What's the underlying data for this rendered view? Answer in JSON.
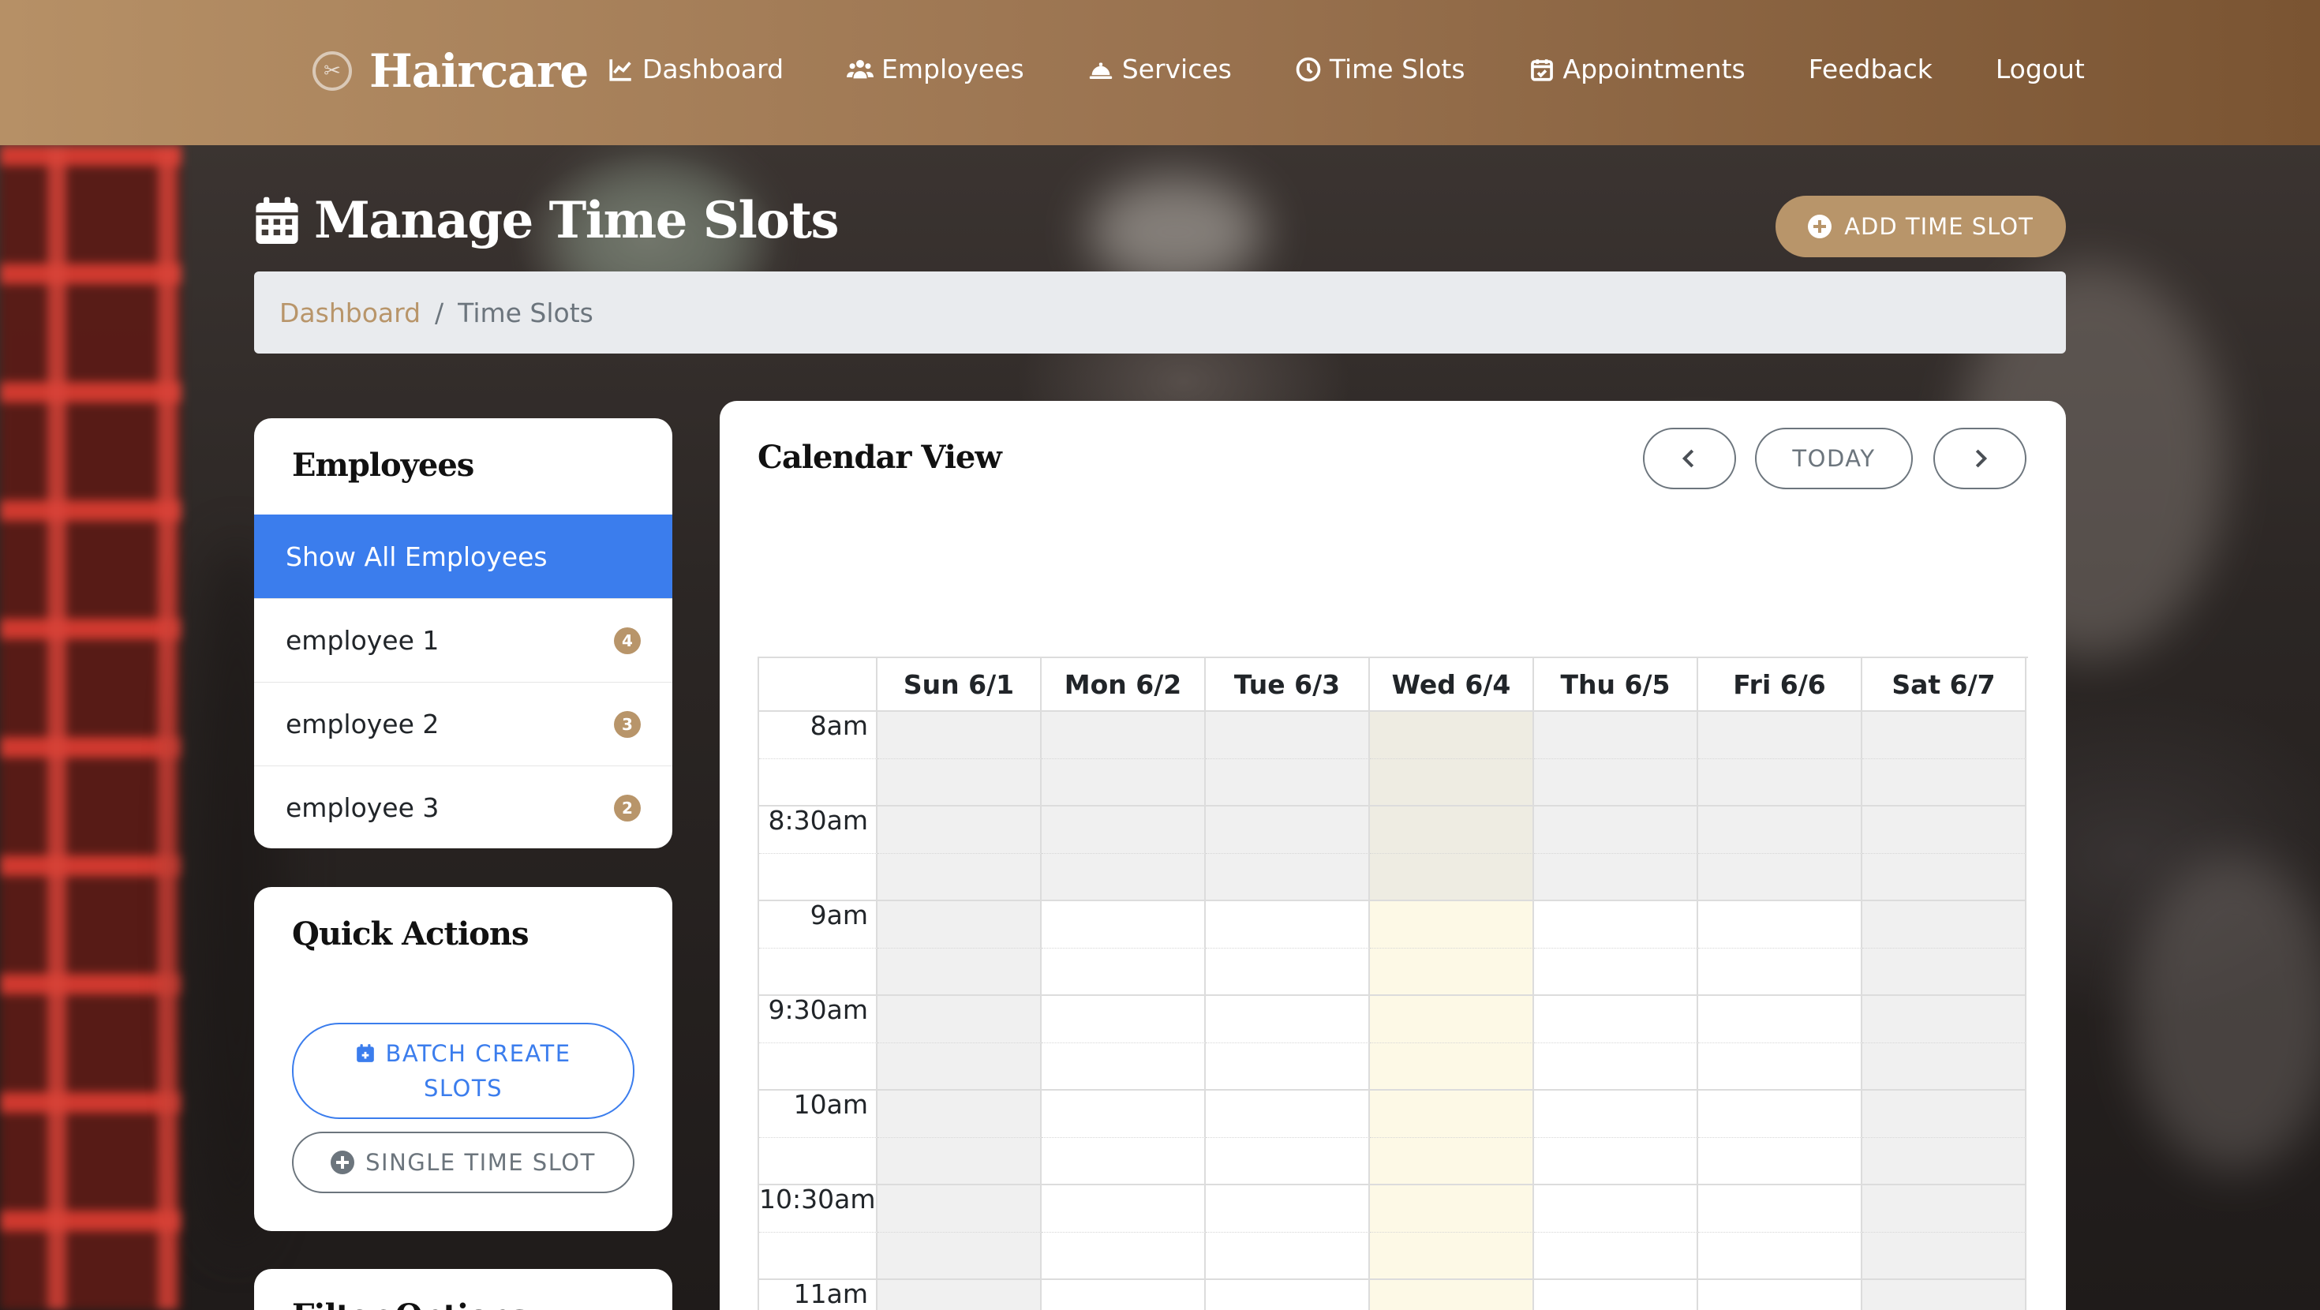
{
  "app": {
    "brand": "Haircare"
  },
  "nav": [
    {
      "label": "Dashboard",
      "icon": "chart-line-icon"
    },
    {
      "label": "Employees",
      "icon": "users-icon"
    },
    {
      "label": "Services",
      "icon": "bell-concierge-icon"
    },
    {
      "label": "Time Slots",
      "icon": "clock-icon"
    },
    {
      "label": "Appointments",
      "icon": "calendar-check-icon"
    },
    {
      "label": "Feedback",
      "icon": ""
    },
    {
      "label": "Logout",
      "icon": ""
    }
  ],
  "page": {
    "title": "Manage Time Slots",
    "add_button": "ADD TIME SLOT"
  },
  "breadcrumb": {
    "link": "Dashboard",
    "separator": "/",
    "current": "Time Slots"
  },
  "employees": {
    "title": "Employees",
    "show_all": "Show All Employees",
    "items": [
      {
        "name": "employee 1",
        "count": "4"
      },
      {
        "name": "employee 2",
        "count": "3"
      },
      {
        "name": "employee 3",
        "count": "2"
      }
    ]
  },
  "quick_actions": {
    "title": "Quick Actions",
    "batch_line1": "BATCH CREATE",
    "batch_line2": "SLOTS",
    "single": "SINGLE TIME SLOT"
  },
  "filter": {
    "title": "Filter Options"
  },
  "calendar": {
    "title": "Calendar View",
    "today_label": "TODAY",
    "days": [
      "Sun 6/1",
      "Mon 6/2",
      "Tue 6/3",
      "Wed 6/4",
      "Thu 6/5",
      "Fri 6/6",
      "Sat 6/7"
    ],
    "today_index": 3,
    "times": [
      "8am",
      "8:30am",
      "9am",
      "9:30am",
      "10am",
      "10:30am",
      "11am"
    ],
    "off_hours_rows": 4,
    "weekend_off": [
      0,
      6
    ]
  },
  "colors": {
    "accent": "#b8956a",
    "active_blue": "#3b7ded",
    "today_highlight": "#fdf9e6"
  }
}
